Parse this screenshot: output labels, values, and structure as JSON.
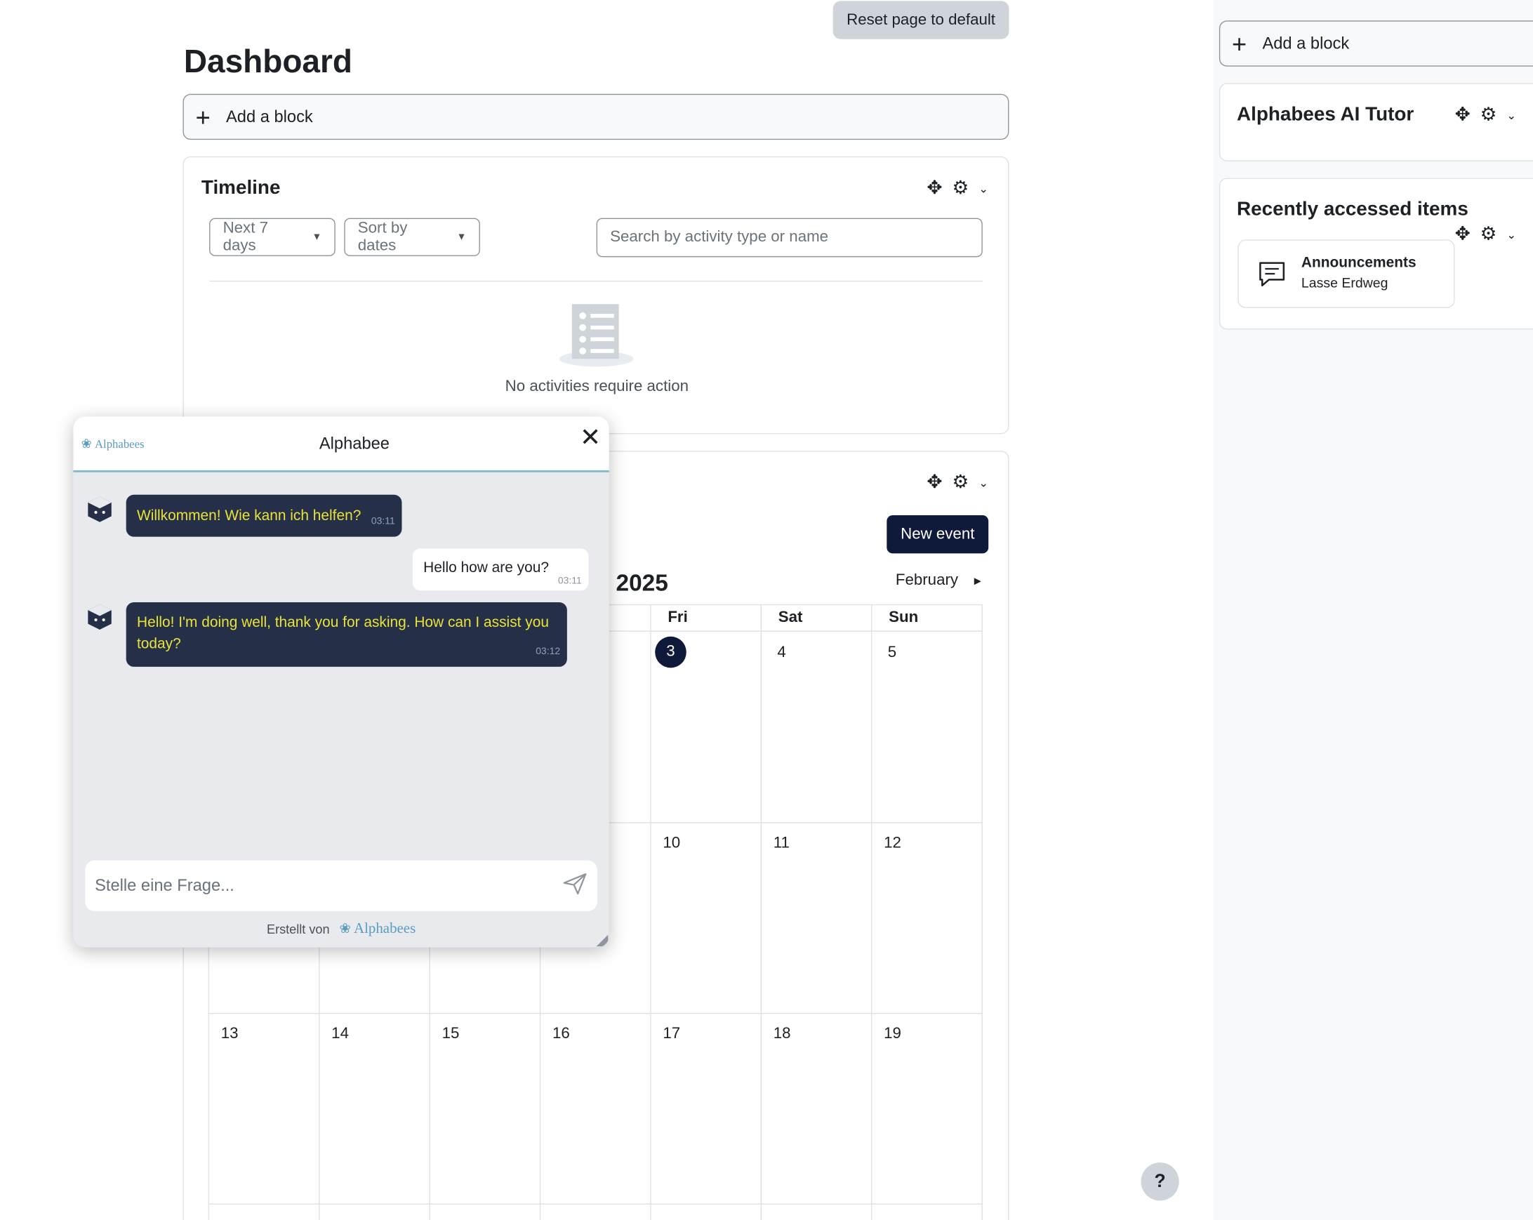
{
  "header": {
    "reset_label": "Reset page to default",
    "title": "Dashboard"
  },
  "main": {
    "add_block_label": "Add a block"
  },
  "timeline": {
    "title": "Timeline",
    "filter_label": "Next 7 days",
    "sort_label": "Sort by dates",
    "search_placeholder": "Search by activity type or name",
    "empty_text": "No activities require action"
  },
  "calendar": {
    "new_event_label": "New event",
    "month_title": "2025",
    "next_month_label": "February",
    "day_headers": [
      "Fri",
      "Sat",
      "Sun"
    ],
    "today": "3",
    "week1": [
      "3",
      "4",
      "5"
    ],
    "week2": [
      "10",
      "11",
      "12"
    ],
    "week3": [
      "13",
      "14",
      "15",
      "16",
      "17",
      "18",
      "19"
    ]
  },
  "sidebar": {
    "add_block_label": "Add a block",
    "tutor_title": "Alphabees AI Tutor",
    "recent_title": "Recently accessed items",
    "recent_item": {
      "name": "Announcements",
      "course": "Lasse Erdweg"
    }
  },
  "chat": {
    "logo_text": "Alphabees",
    "title": "Alphabee",
    "messages": [
      {
        "role": "bot",
        "text": "Willkommen! Wie kann ich helfen?",
        "time": "03:11"
      },
      {
        "role": "user",
        "text": "Hello how are you?",
        "time": "03:11"
      },
      {
        "role": "bot",
        "text": "Hello! I'm doing well, thank you for asking. How can I assist you today?",
        "time": "03:12"
      }
    ],
    "input_placeholder": "Stelle eine Frage...",
    "footer_label": "Erstellt von",
    "footer_brand": "Alphabees"
  },
  "help_label": "?"
}
